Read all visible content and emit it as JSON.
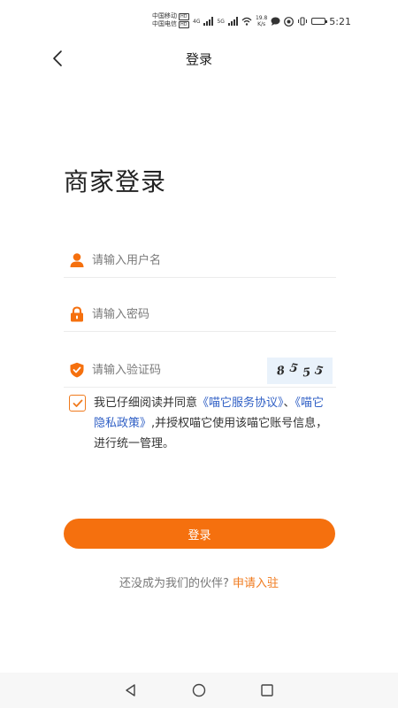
{
  "status_bar": {
    "carrier1": "中国移动",
    "carrier2": "中国电信",
    "hd": "HD",
    "net1": "4G",
    "net2": "5G",
    "speed_value": "19.8",
    "speed_unit": "K/s",
    "time": "5:21",
    "battery_level": 0.8
  },
  "nav": {
    "title": "登录"
  },
  "page": {
    "heading": "商家登录"
  },
  "form": {
    "username_placeholder": "请输入用户名",
    "password_placeholder": "请输入密码",
    "code_placeholder": "请输入验证码",
    "captcha": [
      "8",
      "5",
      "5",
      "5"
    ]
  },
  "agreement": {
    "checked": true,
    "text_before": "我已仔细阅读并同意",
    "link_service": "《喵它服务协议》",
    "separator": "、",
    "link_privacy": "《喵它隐私政策》",
    "text_after": ",并授权喵它使用该喵它账号信息，进行统一管理。"
  },
  "login_button": "登录",
  "register": {
    "prompt": "还没成为我们的伙伴?",
    "link": "申请入驻"
  },
  "colors": {
    "accent": "#f5700e",
    "link": "#2f5fc5"
  }
}
